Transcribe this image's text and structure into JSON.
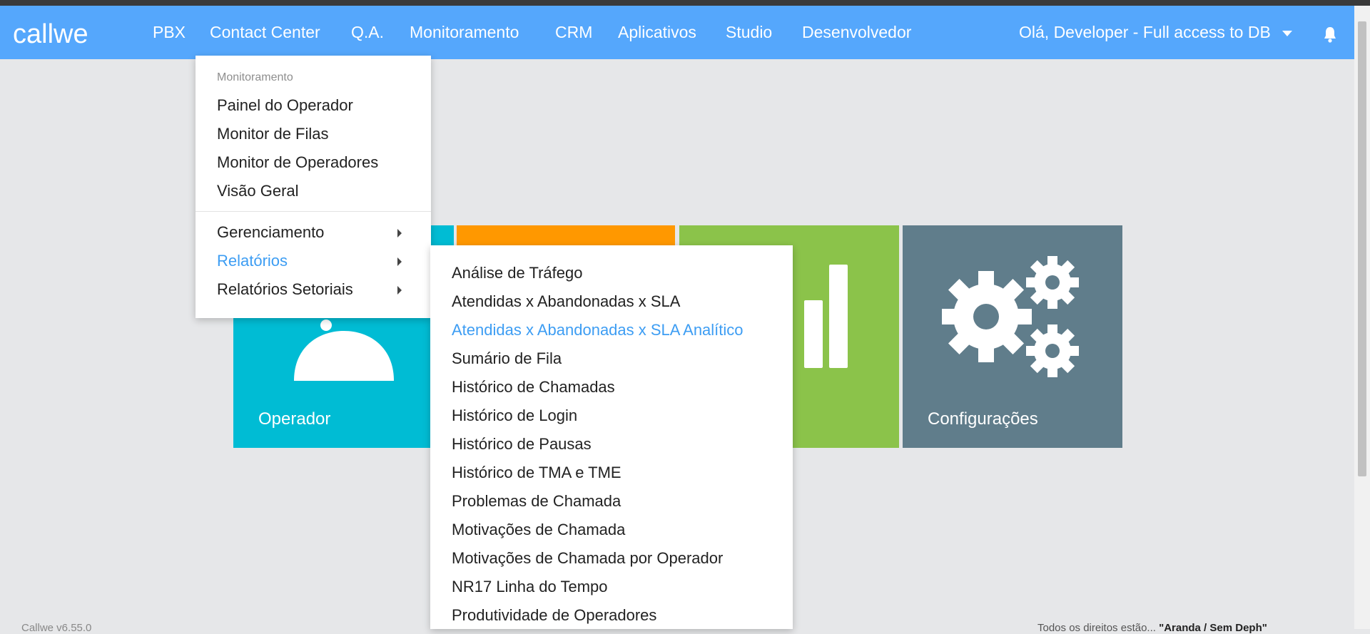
{
  "app": {
    "logo_text": "callwe"
  },
  "nav": {
    "items": [
      "PBX",
      "Contact Center",
      "Q.A.",
      "Monitoramento",
      "CRM",
      "Aplicativos",
      "Studio",
      "Desenvolvedor"
    ],
    "user_greeting": "Olá, Developer - Full access to DB",
    "icons": {
      "caret": "chevron-down-icon",
      "bell": "bell-icon"
    }
  },
  "dropdown": {
    "header": "Monitoramento",
    "items": [
      "Painel do Operador",
      "Monitor de Filas",
      "Monitor de Operadores",
      "Visão Geral"
    ],
    "sub_items": [
      "Gerenciamento",
      "Relatórios",
      "Relatórios Setoriais"
    ],
    "active_sub_item": "Relatórios"
  },
  "submenu": {
    "items": [
      "Análise de Tráfego",
      "Atendidas x Abandonadas x SLA",
      "Atendidas x Abandonadas x SLA Analítico",
      "Sumário de Fila",
      "Histórico de Chamadas",
      "Histórico de Login",
      "Histórico de Pausas",
      "Histórico de TMA e TME",
      "Problemas de Chamada",
      "Motivações de Chamada",
      "Motivações de Chamada por Operador",
      "NR17 Linha do Tempo",
      "Produtividade de Operadores"
    ],
    "active_item": "Atendidas x Abandonadas x SLA Analítico"
  },
  "tiles": {
    "operador": "Operador",
    "configuracoes": "Configurações"
  },
  "footer": {
    "left": "Callwe v6.55.0",
    "right_prefix": "Todos os direitos estão... ",
    "right_bold": "\"Aranda / Sem Deph\""
  },
  "colors": {
    "navbar": "#55a7fc",
    "accent": "#3d9df3",
    "tile_operador": "#00bcd4",
    "tile_orange": "#ff9800",
    "tile_green": "#8bc34a",
    "tile_config": "#607d8b"
  }
}
